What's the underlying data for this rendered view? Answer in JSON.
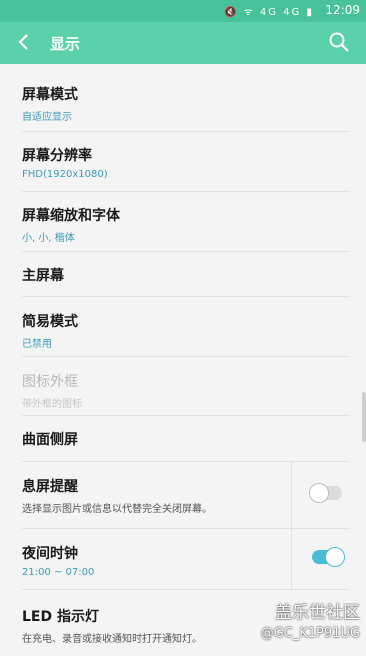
{
  "status": {
    "icons": "🔇 ᯤ 4G 4G ▮",
    "time": "12:09"
  },
  "header": {
    "title": "显示"
  },
  "items": [
    {
      "title": "屏幕模式",
      "subtitle": "自适应显示"
    },
    {
      "title": "屏幕分辨率",
      "subtitle": "FHD(1920x1080)"
    },
    {
      "title": "屏幕缩放和字体",
      "subtitle": "小, 小, 楷体"
    },
    {
      "title": "主屏幕"
    },
    {
      "title": "简易模式",
      "subtitle": "已禁用"
    },
    {
      "title": "图标外框",
      "subtitle": "带外框的图标"
    },
    {
      "title": "曲面侧屏"
    },
    {
      "title": "息屏提醒",
      "description": "选择显示图片或信息以代替完全关闭屏幕。"
    },
    {
      "title": "夜间时钟",
      "subtitle": "21:00 ~ 07:00"
    },
    {
      "title": "LED 指示灯",
      "description": "在充电、录音或接收通知时打开通知灯。"
    }
  ],
  "toggles": {
    "aod": "off",
    "night_clock": "on"
  },
  "watermark": {
    "line1": "盖乐世社区",
    "line2": "@GC_K1P91UG"
  }
}
